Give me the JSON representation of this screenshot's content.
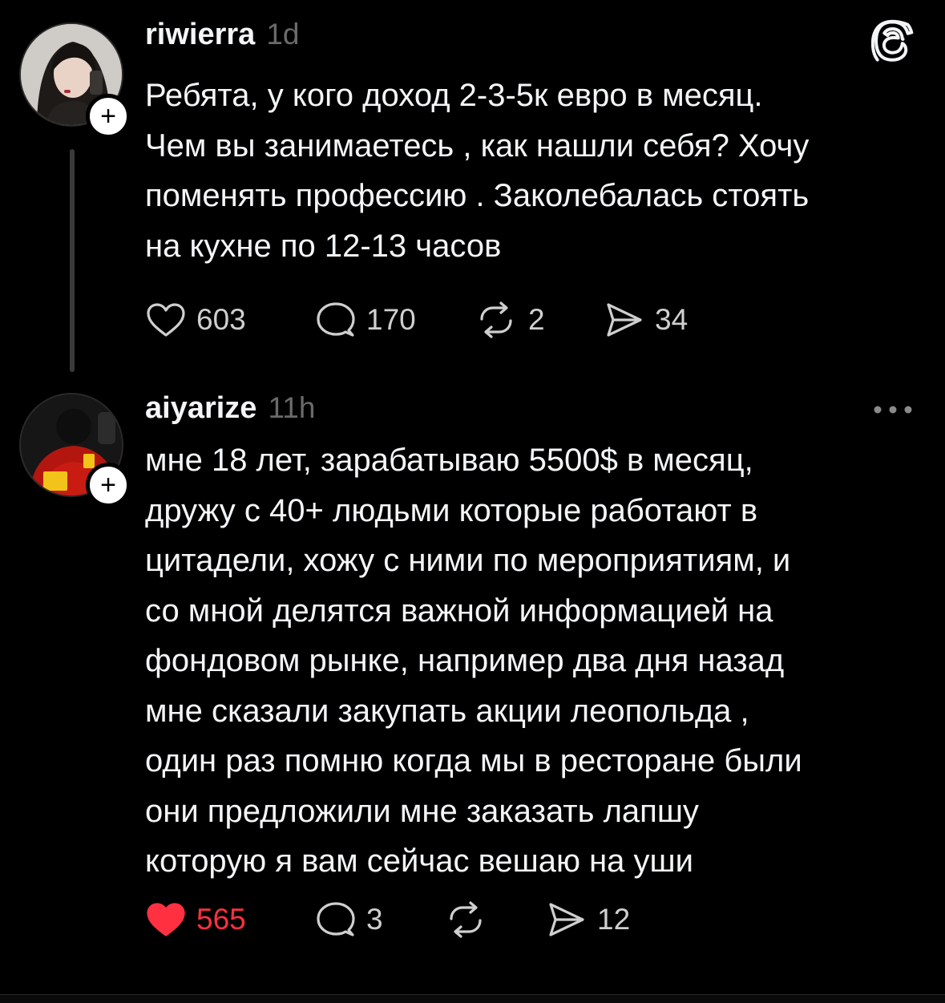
{
  "colors": {
    "background": "#000000",
    "text": "#f3f5f7",
    "muted": "#6a6a6a",
    "liked": "#ff3040"
  },
  "posts": [
    {
      "username": "riwierra",
      "time": "1d",
      "avatar_icon": "avatar-photo",
      "header_icon": "threads-logo-icon",
      "lines": [
        "Ребята, у кого доход 2-3-5к евро в месяц.",
        "Чем вы занимаетесь , как нашли себя? Хочу",
        "поменять профессию . Заколебалась стоять",
        "на кухне по 12-13 часов"
      ],
      "likes": "603",
      "replies": "170",
      "reposts": "2",
      "shares": "34",
      "liked": false
    },
    {
      "username": "aiyarize",
      "time": "11h",
      "avatar_icon": "avatar-photo",
      "header_icon": "more-options-icon",
      "lines": [
        "мне 18 лет, зарабатываю 5500$ в месяц,",
        "дружу с 40+ людьми которые работают в",
        "цитадели, хожу с ними по мероприятиям, и",
        "со мной делятся важной информацией на",
        "фондовом рынке, например два дня назад",
        "мне сказали закупать акции леопольда ,",
        "один раз помню когда мы в ресторане были",
        "они предложили мне заказать лапшу",
        "которую я вам сейчас вешаю на уши"
      ],
      "likes": "565",
      "replies": "3",
      "reposts": "",
      "shares": "12",
      "liked": true
    }
  ]
}
